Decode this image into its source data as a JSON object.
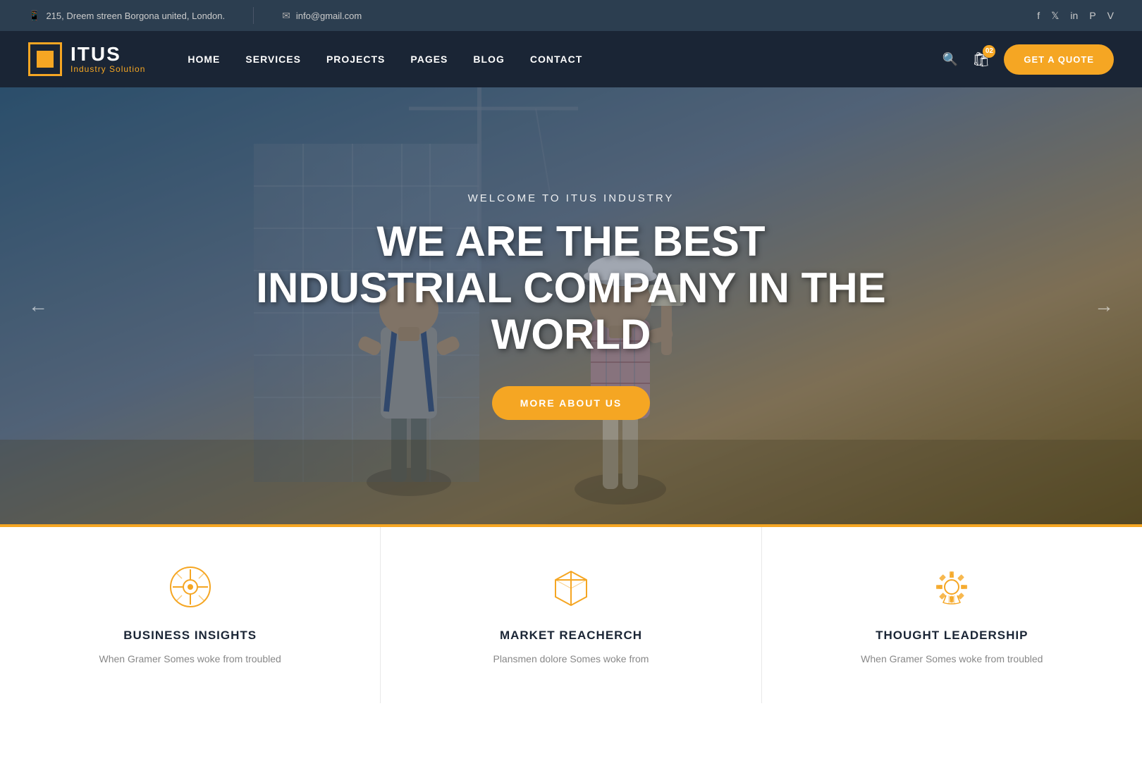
{
  "topbar": {
    "address": "215, Dreem streen Borgona united, London.",
    "email": "info@gmail.com",
    "social": [
      "f",
      "𝕏",
      "in",
      "𝐏",
      "V"
    ]
  },
  "header": {
    "logo_name": "ITUS",
    "logo_tagline": "Industry Solution",
    "nav": [
      {
        "label": "HOME",
        "id": "home"
      },
      {
        "label": "SERVICES",
        "id": "services"
      },
      {
        "label": "PROJECTS",
        "id": "projects"
      },
      {
        "label": "PAGES",
        "id": "pages"
      },
      {
        "label": "BLOG",
        "id": "blog"
      },
      {
        "label": "CONTACT",
        "id": "contact"
      }
    ],
    "cart_count": "02",
    "quote_label": "GET A QUOTE"
  },
  "hero": {
    "subtitle": "WELCOME TO ITUS INDUSTRY",
    "title": "WE ARE THE BEST INDUSTRIAL COMPANY IN THE WORLD",
    "cta_label": "MORE ABOUT US"
  },
  "cards": [
    {
      "id": "business-insights",
      "title": "BUSINESS INSIGHTS",
      "text": "When Gramer Somes woke from troubled"
    },
    {
      "id": "market-research",
      "title": "MARKET REACHERCH",
      "text": "Plansmen dolore Somes woke from"
    },
    {
      "id": "thought-leadership",
      "title": "THOUGHT LEADERSHIP",
      "text": "When Gramer Somes woke from troubled"
    }
  ],
  "colors": {
    "accent": "#f5a623",
    "dark_bg": "#1a2535",
    "top_bar_bg": "#2c3e50"
  }
}
